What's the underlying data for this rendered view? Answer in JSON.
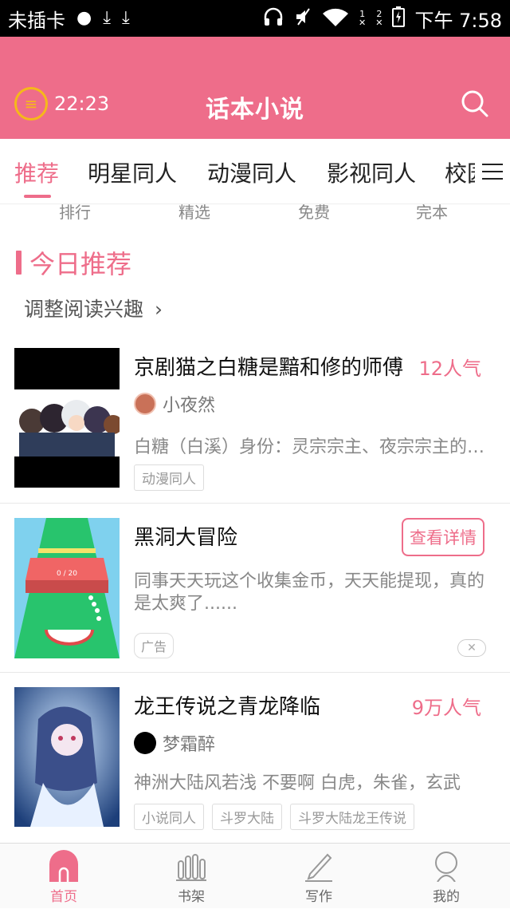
{
  "status_bar": {
    "carrier": "未插卡",
    "time": "下午 7:58",
    "sim1": "1",
    "sim2": "2"
  },
  "app_bar": {
    "timer": "22:23",
    "title": "话本小说"
  },
  "tabs": [
    {
      "label": "推荐",
      "active": true
    },
    {
      "label": "明星同人",
      "active": false
    },
    {
      "label": "动漫同人",
      "active": false
    },
    {
      "label": "影视同人",
      "active": false
    },
    {
      "label": "校园",
      "active": false
    }
  ],
  "subnav": [
    "排行",
    "精选",
    "免费",
    "完本"
  ],
  "section": {
    "title": "今日推荐",
    "adjust": "调整阅读兴趣"
  },
  "books": [
    {
      "name": "京剧猫之白糖是黯和修的师傅",
      "popularity": "12人气",
      "author": "小夜然",
      "desc": "白糖（白溪）身份：灵宗宗主、夜宗宗主的师傅",
      "tags": [
        "动漫同人"
      ]
    },
    {
      "name": "龙王传说之青龙降临",
      "popularity": "9万人气",
      "author": "梦霜醉",
      "desc": "神洲大陆风若浅 不要啊 白虎，朱雀，玄武",
      "tags": [
        "小说同人",
        "斗罗大陆",
        "斗罗大陆龙王传说"
      ]
    }
  ],
  "ad": {
    "name": "黑洞大冒险",
    "button": "查看详情",
    "desc": "同事天天玩这个收集金币，天天能提现，真的是太爽了......",
    "tag": "广告",
    "close": "✕",
    "thumb_text": "0 / 20"
  },
  "bottom_nav": [
    {
      "label": "首页",
      "icon": "home-icon",
      "active": true
    },
    {
      "label": "书架",
      "icon": "bookshelf-icon",
      "active": false
    },
    {
      "label": "写作",
      "icon": "pen-icon",
      "active": false
    },
    {
      "label": "我的",
      "icon": "profile-icon",
      "active": false
    }
  ],
  "colors": {
    "accent": "#ee6d8a",
    "timer": "#f6b81a"
  }
}
